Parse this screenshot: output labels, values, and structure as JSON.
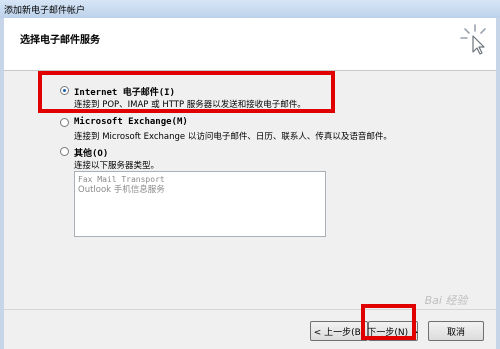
{
  "window": {
    "title": "添加新电子邮件帐户"
  },
  "header": {
    "title": "选择电子邮件服务",
    "icon": "wizard-cursor-icon"
  },
  "options": [
    {
      "label": "Internet 电子邮件(I)",
      "description": "连接到 POP、IMAP 或 HTTP 服务器以发送和接收电子邮件。",
      "checked": true
    },
    {
      "label": "Microsoft Exchange(M)",
      "description": "连接到 Microsoft Exchange 以访问电子邮件、日历、联系人、传真以及语音邮件。",
      "checked": false
    },
    {
      "label": "其他(O)",
      "description": "连接以下服务器类型。",
      "checked": false
    }
  ],
  "other_list": [
    "Fax Mail Transport",
    "Outlook 手机信息服务"
  ],
  "buttons": {
    "back": "< 上一步(B)",
    "next": "下一步(N) >",
    "cancel": "取消"
  },
  "watermark": "Bai 经验",
  "colors": {
    "highlight": "#e00000",
    "accent": "#1b5fb0"
  }
}
